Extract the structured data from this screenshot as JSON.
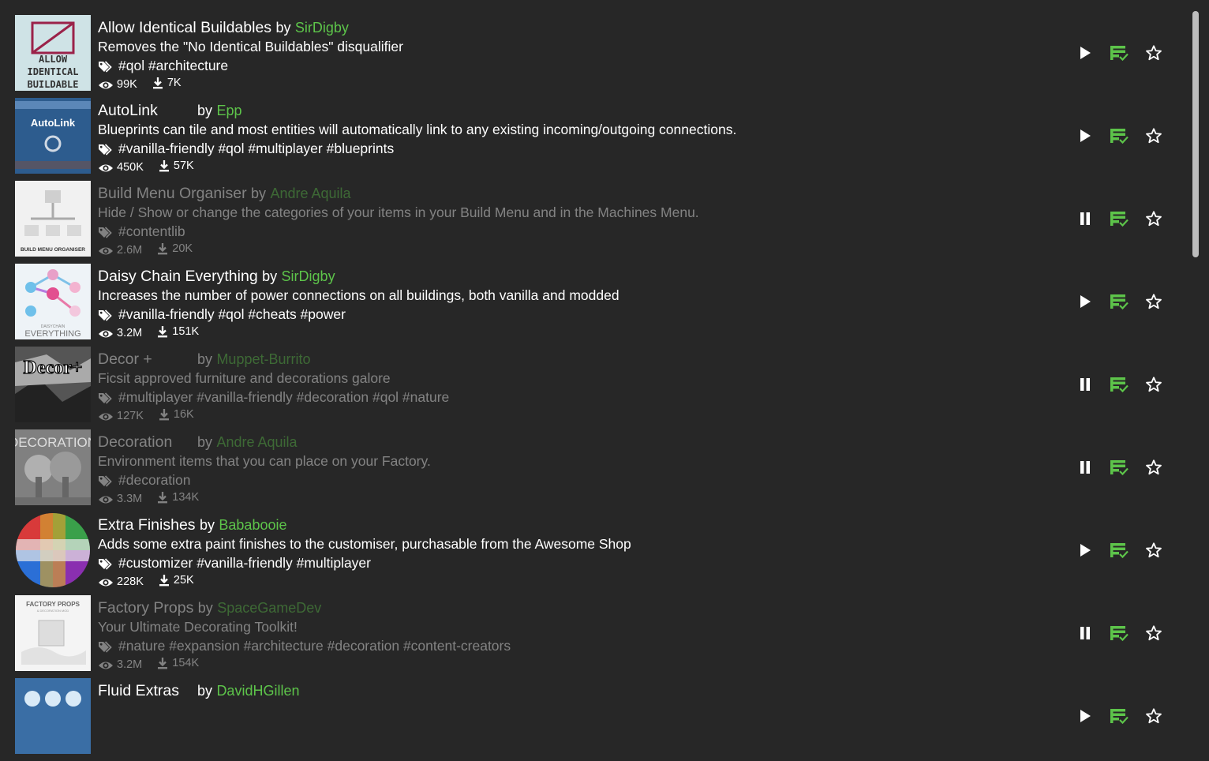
{
  "colors": {
    "background": "#272727",
    "accent": "#5dc44a",
    "text": "#ffffff"
  },
  "mods": [
    {
      "name": "Allow Identical Buildables",
      "by": "by",
      "author": "SirDigby",
      "description": "Removes the \"No Identical Buildables\" disqualifier",
      "tags": "#qol #architecture",
      "views": "99K",
      "downloads": "7K",
      "enabled": true,
      "thumb_text": [
        "ALLOW",
        "IDENTICAL",
        "BUILDABLE"
      ]
    },
    {
      "name": "AutoLink",
      "by": "by",
      "author": "Epp",
      "description": "Blueprints can tile and most entities will automatically link to any existing incoming/outgoing connections.",
      "tags": "#vanilla-friendly #qol #multiplayer #blueprints",
      "views": "450K",
      "downloads": "57K",
      "enabled": true,
      "thumb_text": [
        "AutoLink"
      ]
    },
    {
      "name": "Build Menu Organiser",
      "by": "by",
      "author": "Andre Aquila",
      "description": "Hide / Show or change the categories of your items in your Build Menu and in the Machines Menu.",
      "tags": "#contentlib",
      "views": "2.6M",
      "downloads": "20K",
      "enabled": false,
      "thumb_text": [
        "BUILD MENU ORGANISER"
      ]
    },
    {
      "name": "Daisy Chain Everything",
      "by": "by",
      "author": "SirDigby",
      "description": "Increases the number of power connections on all buildings, both vanilla and modded",
      "tags": "#vanilla-friendly #qol #cheats #power",
      "views": "3.2M",
      "downloads": "151K",
      "enabled": true,
      "thumb_text": [
        "DAISYCHAIN",
        "EVERYTHING"
      ]
    },
    {
      "name": "Decor +",
      "by": "by",
      "author": "Muppet-Burrito",
      "description": "Ficsit approved furniture and decorations galore",
      "tags": "#multiplayer #vanilla-friendly #decoration #qol #nature",
      "views": "127K",
      "downloads": "16K",
      "enabled": false,
      "thumb_text": [
        "Decor+"
      ]
    },
    {
      "name": "Decoration",
      "by": "by",
      "author": "Andre Aquila",
      "description": "Environment items that you can place on your Factory.",
      "tags": "#decoration",
      "views": "3.3M",
      "downloads": "134K",
      "enabled": false,
      "thumb_text": [
        "DECORATION"
      ]
    },
    {
      "name": "Extra Finishes",
      "by": "by",
      "author": "Bababooie",
      "description": "Adds some extra paint finishes to the customiser, purchasable from the Awesome Shop",
      "tags": "#customizer #vanilla-friendly #multiplayer",
      "views": "228K",
      "downloads": "25K",
      "enabled": true,
      "thumb_text": []
    },
    {
      "name": "Factory Props",
      "by": "by",
      "author": "SpaceGameDev",
      "description": "Your Ultimate Decorating Toolkit!",
      "tags": "#nature #expansion #architecture #decoration #content-creators",
      "views": "3.2M",
      "downloads": "154K",
      "enabled": false,
      "thumb_text": [
        "FACTORY PROPS",
        "& DECORATION MOD"
      ]
    },
    {
      "name": "Fluid Extras",
      "by": "by",
      "author": "DavidHGillen",
      "description": "",
      "tags": "",
      "views": "",
      "downloads": "",
      "enabled": true,
      "thumb_text": []
    }
  ]
}
